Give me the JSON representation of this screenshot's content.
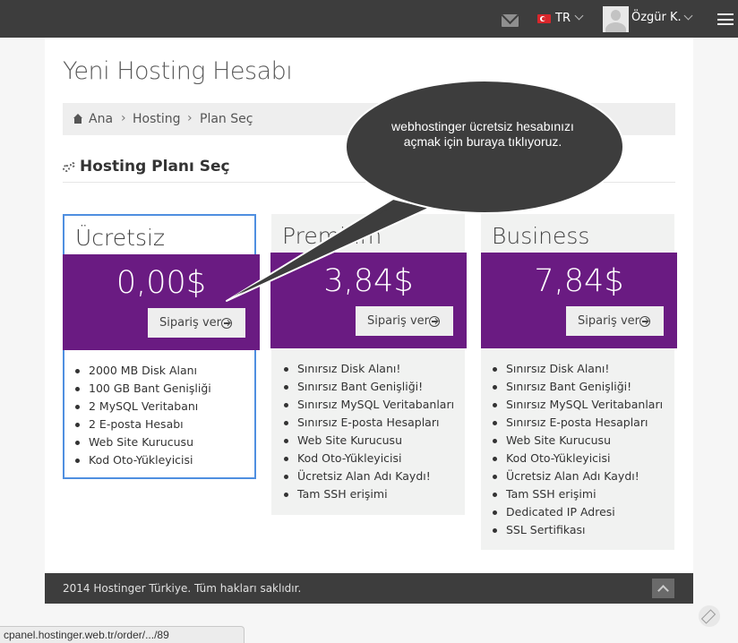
{
  "topbar": {
    "language": "TR",
    "user_name": "Özgür K."
  },
  "page": {
    "title": "Yeni Hosting Hesabı",
    "section_title": "Hosting Planı Seç"
  },
  "breadcrumb": [
    "Ana",
    "Hosting",
    "Plan Seç"
  ],
  "plans": [
    {
      "name": "Ücretsiz",
      "price": "0,00$",
      "order_label": "Sipariş ver",
      "selected": true,
      "features": [
        "2000 MB Disk Alanı",
        "100 GB Bant Genişliği",
        "2 MySQL Veritabanı",
        "2 E-posta Hesabı",
        "Web Site Kurucusu",
        "Kod Oto-Yükleyicisi"
      ]
    },
    {
      "name": "Premium",
      "price": "3,84$",
      "order_label": "Sipariş ver",
      "selected": false,
      "features": [
        "Sınırsız Disk Alanı!",
        "Sınırsız Bant Genişliği!",
        "Sınırsız MySQL Veritabanları",
        "Sınırsız E-posta Hesapları",
        "Web Site Kurucusu",
        "Kod Oto-Yükleyicisi",
        "Ücretsiz Alan Adı Kaydı!",
        "Tam SSH erişimi"
      ]
    },
    {
      "name": "Business",
      "price": "7,84$",
      "order_label": "Sipariş ver",
      "selected": false,
      "features": [
        "Sınırsız Disk Alanı!",
        "Sınırsız Bant Genişliği!",
        "Sınırsız MySQL Veritabanları",
        "Sınırsız E-posta Hesapları",
        "Web Site Kurucusu",
        "Kod Oto-Yükleyicisi",
        "Ücretsiz Alan Adı Kaydı!",
        "Tam SSH erişimi",
        "Dedicated IP Adresi",
        "SSL Sertifikası"
      ]
    }
  ],
  "callout": {
    "text": "webhostinger ücretsiz hesabınızı açmak için buraya tıklıyoruz."
  },
  "footer": {
    "copyright": "2014 Hostinger Türkiye. Tüm hakları saklıdır."
  },
  "statusbar": {
    "url": "cpanel.hostinger.web.tr/order/.../89"
  },
  "colors": {
    "accent_purple": "#6a1b82",
    "selected_border": "#4f8fe0",
    "navbar": "#3d3d3d",
    "callout": "#3d3d3d"
  },
  "icons": [
    "mail-icon",
    "flag-tr-icon",
    "chevron-down-icon",
    "avatar-icon",
    "hamburger-menu-icon",
    "home-icon",
    "cogs-icon",
    "arrow-circle-right-icon",
    "chevron-up-icon",
    "pencil-icon"
  ]
}
